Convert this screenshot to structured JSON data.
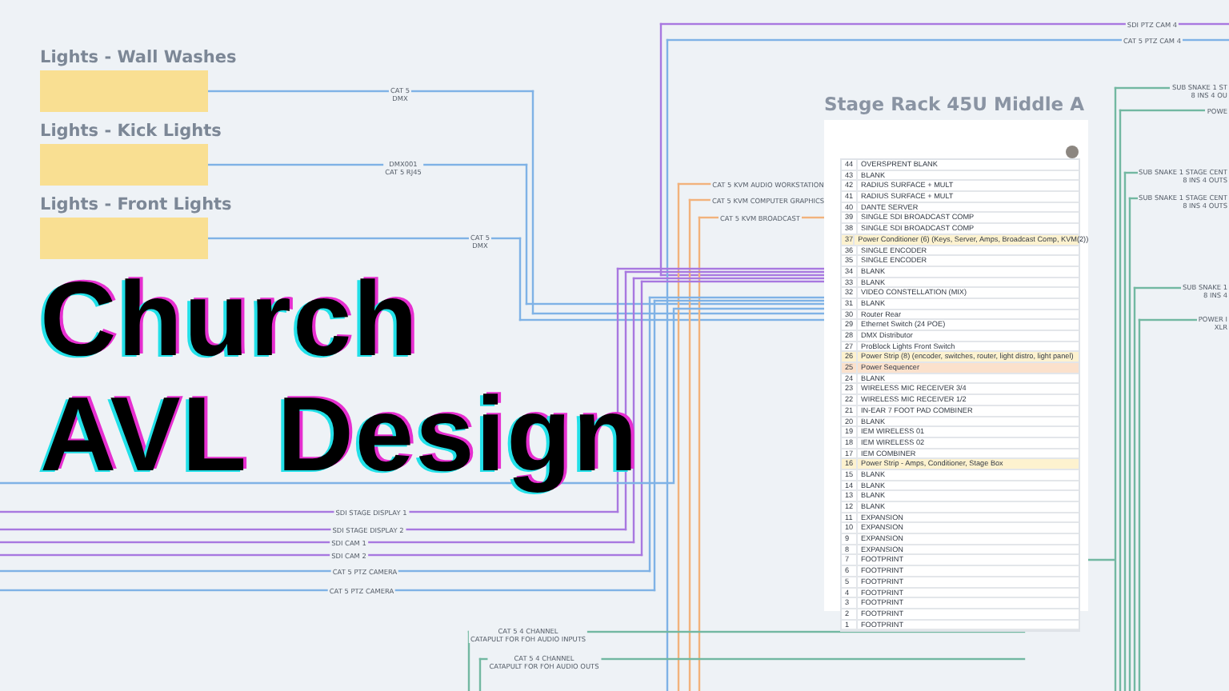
{
  "title": {
    "lines": [
      "Church",
      "AVL Design"
    ]
  },
  "light_groups": [
    {
      "title": "Lights - Wall Washes"
    },
    {
      "title": "Lights - Kick Lights"
    },
    {
      "title": "Lights - Front Lights"
    }
  ],
  "wires": [
    {
      "lines": [
        "CAT 5",
        "DMX"
      ],
      "color": "#7fb2e6"
    },
    {
      "lines": [
        "DMX001",
        "CAT 5 RJ45"
      ],
      "color": "#7fb2e6"
    },
    {
      "lines": [
        "CAT 5",
        "DMX"
      ],
      "color": "#7fb2e6"
    },
    {
      "lines": [
        "SDI PTZ CAM 4"
      ],
      "color": "#a878e0"
    },
    {
      "lines": [
        "CAT 5 PTZ CAM 4"
      ],
      "color": "#7fb2e6"
    },
    {
      "lines": [
        "CAT 5 KVM AUDIO WORKSTATION"
      ],
      "color": "#f2b27c"
    },
    {
      "lines": [
        "CAT 5 KVM COMPUTER GRAPHICS"
      ],
      "color": "#f2b27c"
    },
    {
      "lines": [
        "CAT 5 KVM BROADCAST"
      ],
      "color": "#f2b27c"
    },
    {
      "lines": [
        "SDI STAGE DISPLAY 1"
      ],
      "color": "#a878e0"
    },
    {
      "lines": [
        "SDI STAGE DISPLAY 2"
      ],
      "color": "#a878e0"
    },
    {
      "lines": [
        "SDI CAM 1"
      ],
      "color": "#a878e0"
    },
    {
      "lines": [
        "SDI CAM 2"
      ],
      "color": "#a878e0"
    },
    {
      "lines": [
        "CAT 5 PTZ CAMERA"
      ],
      "color": "#7fb2e6"
    },
    {
      "lines": [
        "CAT 5 PTZ CAMERA"
      ],
      "color": "#7fb2e6"
    },
    {
      "lines": [
        "CAT 5 4 CHANNEL",
        "CATAPULT FOR FOH AUDIO INPUTS"
      ],
      "color": "#72b8a2"
    },
    {
      "lines": [
        "CAT 5 4 CHANNEL",
        "CATAPULT FOR FOH AUDIO OUTS"
      ],
      "color": "#72b8a2"
    },
    {
      "lines": [
        "SUB SNAKE 1 ST",
        "8 INS 4 OU"
      ],
      "color": "#72b8a2"
    },
    {
      "lines": [
        "POWE"
      ],
      "color": "#72b8a2"
    },
    {
      "lines": [
        "SUB SNAKE 1 STAGE CENT",
        "8 INS 4 OUTS"
      ],
      "color": "#72b8a2"
    },
    {
      "lines": [
        "SUB SNAKE 1 STAGE CENT",
        "8 INS 4 OUTS"
      ],
      "color": "#72b8a2"
    },
    {
      "lines": [
        "SUB SNAKE 1",
        "8 INS 4"
      ],
      "color": "#72b8a2"
    },
    {
      "lines": [
        "POWER I",
        "XLR"
      ],
      "color": "#72b8a2"
    }
  ],
  "rack": {
    "title": "Stage Rack 45U Middle A",
    "rows": [
      {
        "unit": "44",
        "name": "OVERSPRENT BLANK",
        "kind": "plain"
      },
      {
        "unit": "43",
        "name": "BLANK",
        "kind": "plain"
      },
      {
        "unit": "42",
        "name": "RADIUS SURFACE + MULT",
        "kind": "plain"
      },
      {
        "unit": "41",
        "name": "RADIUS SURFACE + MULT",
        "kind": "plain"
      },
      {
        "unit": "40",
        "name": "DANTE SERVER",
        "kind": "plain"
      },
      {
        "unit": "39",
        "name": "SINGLE SDI BROADCAST COMP",
        "kind": "plain"
      },
      {
        "unit": "38",
        "name": "SINGLE SDI BROADCAST COMP",
        "kind": "plain"
      },
      {
        "unit": "37",
        "name": "Power Conditioner (6) (Keys, Server, Amps, Broadcast Comp, KVM(2))",
        "kind": "power"
      },
      {
        "unit": "36",
        "name": "SINGLE ENCODER",
        "kind": "plain"
      },
      {
        "unit": "35",
        "name": "SINGLE ENCODER",
        "kind": "plain"
      },
      {
        "unit": "34",
        "name": "BLANK",
        "kind": "plain"
      },
      {
        "unit": "33",
        "name": "BLANK",
        "kind": "plain"
      },
      {
        "unit": "32",
        "name": "VIDEO CONSTELLATION (MIX)",
        "kind": "plain"
      },
      {
        "unit": "31",
        "name": "BLANK",
        "kind": "plain"
      },
      {
        "unit": "30",
        "name": "Router Rear",
        "kind": "plain"
      },
      {
        "unit": "29",
        "name": "Ethernet Switch (24 POE)",
        "kind": "plain"
      },
      {
        "unit": "28",
        "name": "DMX Distributor",
        "kind": "plain"
      },
      {
        "unit": "27",
        "name": "ProBlock Lights Front Switch",
        "kind": "plain"
      },
      {
        "unit": "26",
        "name": "Power Strip (8) (encoder, switches, router, light distro, light panel)",
        "kind": "power"
      },
      {
        "unit": "25",
        "name": "Power Sequencer",
        "kind": "sequencer"
      },
      {
        "unit": "24",
        "name": "BLANK",
        "kind": "plain"
      },
      {
        "unit": "23",
        "name": "WIRELESS MIC RECEIVER 3/4",
        "kind": "plain"
      },
      {
        "unit": "22",
        "name": "WIRELESS MIC RECEIVER 1/2",
        "kind": "plain"
      },
      {
        "unit": "21",
        "name": "IN-EAR 7 FOOT PAD COMBINER",
        "kind": "plain"
      },
      {
        "unit": "20",
        "name": "BLANK",
        "kind": "plain"
      },
      {
        "unit": "19",
        "name": "IEM WIRELESS 01",
        "kind": "plain"
      },
      {
        "unit": "18",
        "name": "IEM WIRELESS 02",
        "kind": "plain"
      },
      {
        "unit": "17",
        "name": "IEM COMBINER",
        "kind": "plain"
      },
      {
        "unit": "16",
        "name": "Power Strip - Amps, Conditioner, Stage Box",
        "kind": "power"
      },
      {
        "unit": "15",
        "name": "BLANK",
        "kind": "plain"
      },
      {
        "unit": "14",
        "name": "BLANK",
        "kind": "plain"
      },
      {
        "unit": "13",
        "name": "BLANK",
        "kind": "plain"
      },
      {
        "unit": "12",
        "name": "BLANK",
        "kind": "plain"
      },
      {
        "unit": "11",
        "name": "EXPANSION",
        "kind": "plain"
      },
      {
        "unit": "10",
        "name": "EXPANSION",
        "kind": "plain"
      },
      {
        "unit": "9",
        "name": "EXPANSION",
        "kind": "plain"
      },
      {
        "unit": "8",
        "name": "EXPANSION",
        "kind": "plain"
      },
      {
        "unit": "7",
        "name": "FOOTPRINT",
        "kind": "plain"
      },
      {
        "unit": "6",
        "name": "FOOTPRINT",
        "kind": "plain"
      },
      {
        "unit": "5",
        "name": "FOOTPRINT",
        "kind": "plain"
      },
      {
        "unit": "4",
        "name": "FOOTPRINT",
        "kind": "plain"
      },
      {
        "unit": "3",
        "name": "FOOTPRINT",
        "kind": "plain"
      },
      {
        "unit": "2",
        "name": "FOOTPRINT",
        "kind": "plain"
      },
      {
        "unit": "1",
        "name": "FOOTPRINT",
        "kind": "plain"
      }
    ]
  }
}
